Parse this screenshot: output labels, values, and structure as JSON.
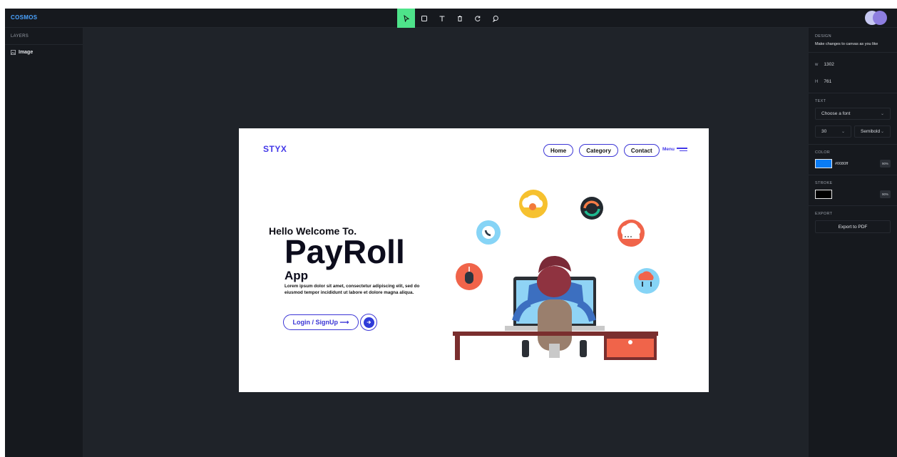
{
  "app": {
    "brand": "COSMOS"
  },
  "toolbar": {
    "tools": [
      {
        "name": "select",
        "icon": "cursor-icon",
        "active": true
      },
      {
        "name": "rectangle",
        "icon": "square-icon"
      },
      {
        "name": "text",
        "icon": "text-icon"
      },
      {
        "name": "delete",
        "icon": "trash-icon"
      },
      {
        "name": "redo",
        "icon": "rotate-icon"
      },
      {
        "name": "comment",
        "icon": "comment-icon"
      }
    ],
    "active_color": "#4ee38a"
  },
  "layers": {
    "title": "LAYERS",
    "items": [
      {
        "label": "Image",
        "icon": "image-icon"
      }
    ]
  },
  "design": {
    "title": "DESIGN",
    "description": "Make changes to canvas as you like",
    "width_label": "w",
    "width_value": "1302",
    "height_label": "H",
    "height_value": "761",
    "text_title": "TEXT",
    "font_placeholder": "Choose a font",
    "font_size": "30",
    "font_weight": "Semibold",
    "color_title": "COLOR",
    "color_value": "#0080ff",
    "color_opacity": "90%",
    "stroke_title": "STROKE",
    "stroke_opacity": "90%",
    "export_title": "EXPORT",
    "export_button": "Export to PDF"
  },
  "artboard": {
    "logo": "STYX",
    "nav": [
      "Home",
      "Category",
      "Contact"
    ],
    "menu": "Menu",
    "hello": "Hello Welcome To.",
    "title": "PayRoll",
    "subtitle": "App",
    "lorem": "Lorem ipsum dolor sit amet, consectetur adipiscing elit, sed do eiusmod tempor incididunt ut labore et dolore magna aliqua.",
    "cta": "Login / SignUp ⟶",
    "accent": "#3b35d6"
  }
}
